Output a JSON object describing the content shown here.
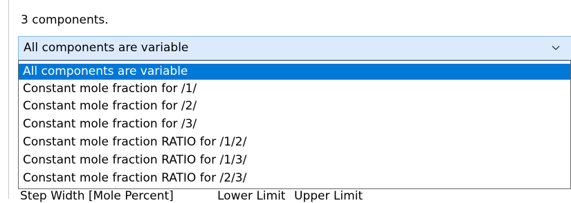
{
  "header": {
    "count_label": "3 components."
  },
  "combo": {
    "selected_value": "All components are variable",
    "arrow_icon": "chevron-down-icon"
  },
  "dropdown": {
    "options": [
      "All components are variable",
      "Constant mole fraction for /1/",
      "Constant mole fraction for /2/",
      "Constant mole fraction for /3/",
      "Constant mole fraction RATIO for /1/2/",
      "Constant mole fraction RATIO for /1/3/",
      "Constant mole fraction RATIO for /2/3/"
    ],
    "highlighted_index": 0
  },
  "bottom_labels": {
    "step_width": "Step Width [Mole Percent]",
    "lower_limit": "Lower Limit",
    "upper_limit": "Upper Limit"
  },
  "colors": {
    "combo_background": "#dcebfc",
    "combo_border": "#7eb4ea",
    "selection_highlight": "#0078d7",
    "list_border": "#646464"
  }
}
